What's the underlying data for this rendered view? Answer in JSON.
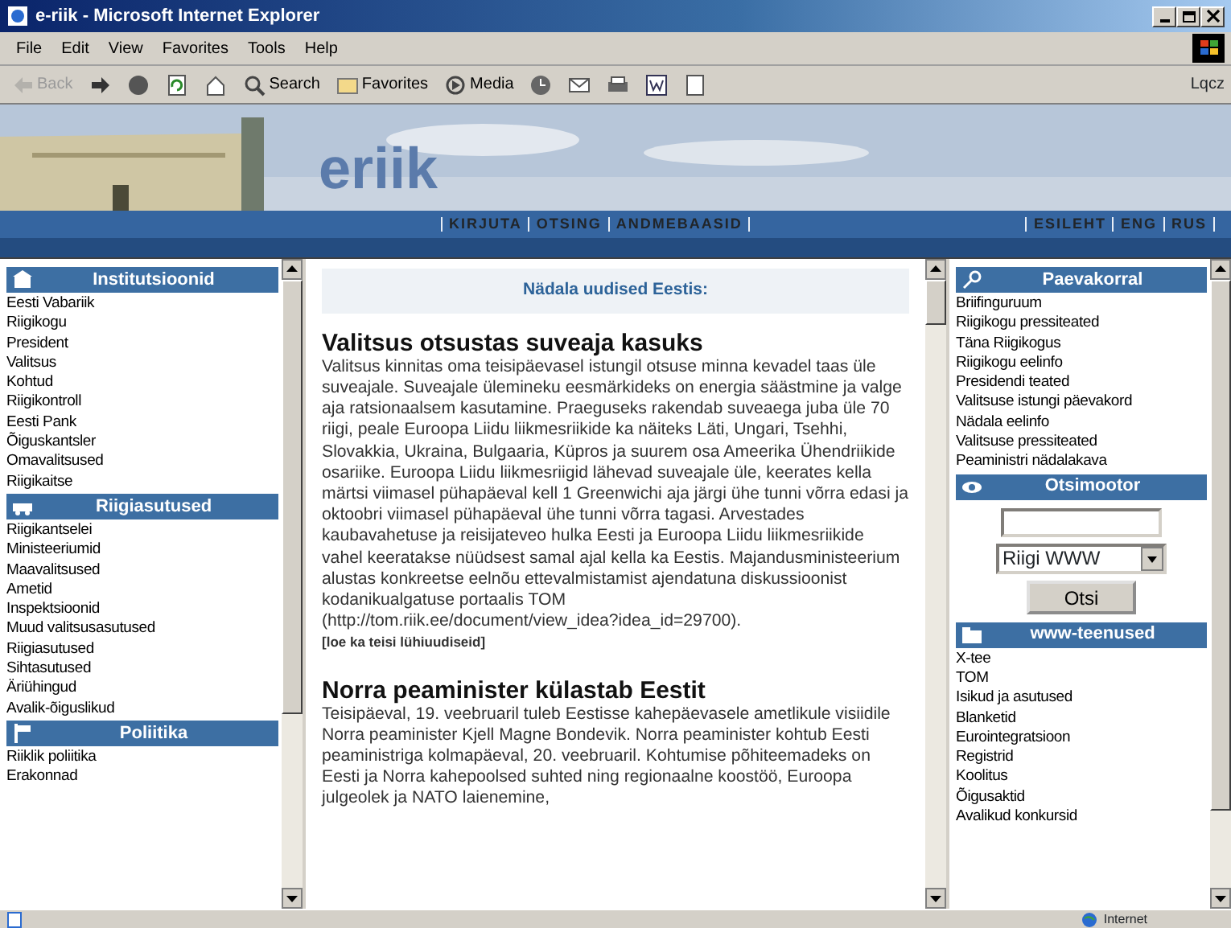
{
  "window": {
    "title": "e-riik - Microsoft Internet Explorer"
  },
  "menu": [
    "File",
    "Edit",
    "View",
    "Favorites",
    "Tools",
    "Help"
  ],
  "toolbar": [
    {
      "kind": "back",
      "label": "Back",
      "disabled": true
    },
    {
      "kind": "forward",
      "disabled": false
    },
    {
      "kind": "stop",
      "disabled": false
    },
    {
      "kind": "refresh",
      "disabled": false
    },
    {
      "kind": "home",
      "disabled": false
    },
    {
      "kind": "search",
      "label": "Search",
      "disabled": false
    },
    {
      "kind": "favorites",
      "label": "Favorites",
      "disabled": false
    },
    {
      "kind": "media",
      "label": "Media",
      "disabled": false
    },
    {
      "kind": "history",
      "disabled": false
    },
    {
      "kind": "mail",
      "disabled": false
    },
    {
      "kind": "print",
      "disabled": false
    },
    {
      "kind": "edit",
      "disabled": false
    },
    {
      "kind": "discuss",
      "disabled": false
    }
  ],
  "links_label": "Lqcz",
  "banner": {
    "logo": "eriik",
    "nav_left": [
      "KIRJUTA",
      "OTSING",
      "ANDMEBAASID"
    ],
    "nav_right": [
      "ESILEHT",
      "ENG",
      "RUS"
    ]
  },
  "left_sidebar": [
    {
      "title": "Institutsioonid",
      "items": [
        "Eesti Vabariik",
        "Riigikogu",
        "President",
        "Valitsus",
        "Kohtud",
        "Riigikontroll",
        "Eesti Pank",
        "Õiguskantsler",
        "Omavalitsused",
        "Riigikaitse"
      ]
    },
    {
      "title": "Riigiasutused",
      "items": [
        "Riigikantselei",
        "Ministeeriumid",
        "Maavalitsused",
        "Ametid",
        "Inspektsioonid",
        "Muud valitsusasutused",
        "Riigiasutused",
        "Sihtasutused",
        "Äriühingud",
        "Avalik-õiguslikud"
      ]
    },
    {
      "title": "Poliitika",
      "items": [
        "Riiklik poliitika",
        "Erakonnad"
      ]
    }
  ],
  "center": {
    "heading": "Nädala uudised Eestis:",
    "articles": [
      {
        "title": "Valitsus otsustas suveaja kasuks",
        "body": "Valitsus kinnitas oma teisipäevasel istungil otsuse minna kevadel taas üle suveajale. Suveajale ülemineku eesmärkideks on energia säästmine ja valge aja ratsionaalsem kasutamine. Praeguseks rakendab suveaega juba üle 70 riigi, peale Euroopa Liidu liikmesriikide ka näiteks Läti, Ungari, Tsehhi, Slovakkia, Ukraina, Bulgaaria, Küpros ja suurem osa Ameerika Ühendriikide osariike. Euroopa Liidu liikmesriigid lähevad suveajale üle, keerates kella märtsi viimasel pühapäeval kell 1 Greenwichi aja järgi ühe tunni võrra edasi ja oktoobri viimasel pühapäeval ühe tunni võrra tagasi. Arvestades kaubavahetuse ja reisijateveo hulka Eesti ja Euroopa Liidu liikmesriikide vahel keeratakse nüüdsest samal ajal kella ka Eestis. Majandusministeerium alustas konkreetse eelnõu ettevalmistamist ajendatuna diskussioonist kodanikualgatuse portaalis TOM (",
        "link": "http://tom.riik.ee/document/view_idea?idea_id=29700",
        "after": ").",
        "more": "[loe ka teisi lühiuudiseid]"
      },
      {
        "title": "Norra peaminister külastab Eestit",
        "body": "Teisipäeval, 19. veebruaril tuleb Eestisse kahepäevasele ametlikule visiidile Norra peaminister Kjell Magne Bondevik. Norra peaminister kohtub Eesti peaministriga kolmapäeval, 20. veebruaril. Kohtumise põhiteemadeks on Eesti ja Norra kahepoolsed suhted ning regionaalne koostöö, Euroopa julgeolek ja NATO laienemine,"
      }
    ]
  },
  "right_sidebar": [
    {
      "kind": "list",
      "title": "Paevakorral",
      "items": [
        "Briifinguruum",
        "Riigikogu pressiteated",
        "Täna Riigikogus",
        "Riigikogu eelinfo",
        "Presidendi teated",
        "Valitsuse istungi päevakord",
        "Nädala eelinfo",
        "Valitsuse pressiteated",
        "Peaministri nädalakava"
      ]
    },
    {
      "kind": "search",
      "title": "Otsimootor",
      "select": "Riigi WWW",
      "button": "Otsi"
    },
    {
      "kind": "list",
      "title": "www-teenused",
      "items": [
        "X-tee",
        "TOM",
        "Isikud ja asutused",
        "Blanketid",
        "Eurointegratsioon",
        "Registrid",
        "Koolitus",
        "Õigusaktid",
        "Avalikud konkursid"
      ]
    }
  ],
  "status_bar": {
    "zone": "Internet"
  }
}
